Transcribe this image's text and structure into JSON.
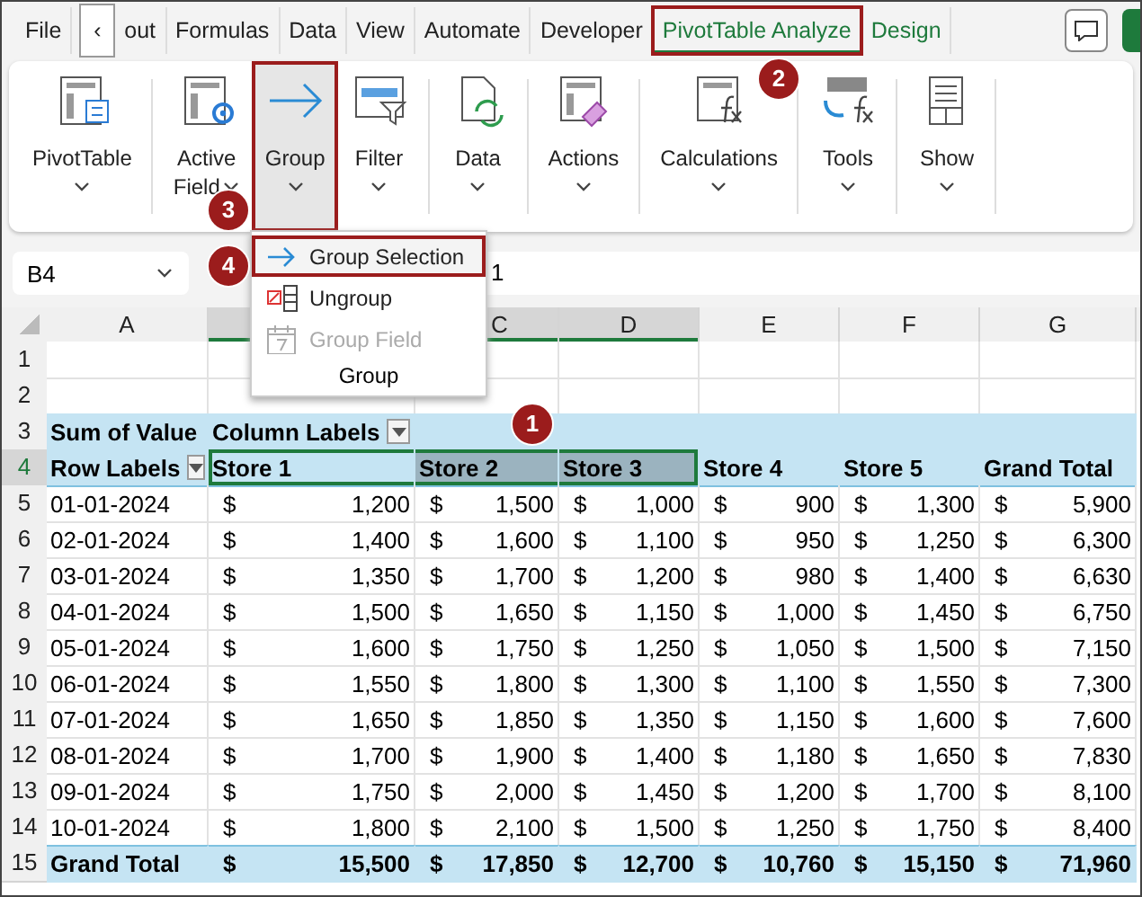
{
  "tabs": [
    {
      "label": "File",
      "kind": "normal",
      "selected": false,
      "outlined": false
    },
    {
      "label": "‹",
      "kind": "scroll",
      "selected": false,
      "outlined": false
    },
    {
      "label": "out",
      "kind": "normal",
      "selected": false,
      "outlined": false
    },
    {
      "label": "Formulas",
      "kind": "normal",
      "selected": false,
      "outlined": false
    },
    {
      "label": "Data",
      "kind": "normal",
      "selected": false,
      "outlined": false
    },
    {
      "label": "View",
      "kind": "normal",
      "selected": false,
      "outlined": false
    },
    {
      "label": "Automate",
      "kind": "normal",
      "selected": false,
      "outlined": false
    },
    {
      "label": "Developer",
      "kind": "normal",
      "selected": false,
      "outlined": false
    },
    {
      "label": "PivotTable Analyze",
      "kind": "contextual",
      "selected": true,
      "outlined": true
    },
    {
      "label": "Design",
      "kind": "contextual",
      "selected": false,
      "outlined": false
    }
  ],
  "ribbon": [
    {
      "buttons": [
        {
          "label": "PivotTable",
          "kind": "pivot",
          "pressed": false,
          "outlined": false
        }
      ]
    },
    {
      "buttons": [
        {
          "label": "Active",
          "label2": "Field",
          "kind": "field",
          "pressed": false,
          "outlined": false
        },
        {
          "label": "Group",
          "kind": "group",
          "pressed": true,
          "outlined": true
        },
        {
          "label": "Filter",
          "kind": "filter",
          "pressed": false,
          "outlined": false
        }
      ]
    },
    {
      "buttons": [
        {
          "label": "Data",
          "kind": "data",
          "pressed": false,
          "outlined": false
        }
      ]
    },
    {
      "buttons": [
        {
          "label": "Actions",
          "kind": "actions",
          "pressed": false,
          "outlined": false
        }
      ]
    },
    {
      "buttons": [
        {
          "label": "Calculations",
          "kind": "calc",
          "pressed": false,
          "outlined": false
        }
      ]
    },
    {
      "buttons": [
        {
          "label": "Tools",
          "kind": "tools",
          "pressed": false,
          "outlined": false
        }
      ]
    },
    {
      "buttons": [
        {
          "label": "Show",
          "kind": "show",
          "pressed": false,
          "outlined": false
        }
      ]
    }
  ],
  "name_box": "B4",
  "formula": "1",
  "menu": {
    "items": [
      {
        "label": "Group Selection",
        "kind": "arrow",
        "disabled": false,
        "selected": true
      },
      {
        "label": "Ungroup",
        "kind": "ungroup",
        "disabled": false,
        "selected": false
      },
      {
        "label": "Group Field",
        "kind": "calendar",
        "disabled": true,
        "selected": false
      }
    ],
    "footer": "Group"
  },
  "sheet": {
    "columns": [
      "A",
      "C",
      "D",
      "E",
      "F",
      "G"
    ],
    "rows": [
      {
        "number": "1",
        "kind": "blank",
        "cells": []
      },
      {
        "number": "2",
        "kind": "blank",
        "cells": []
      },
      {
        "number": "3",
        "kind": "label",
        "cells": [
          {
            "text": "Sum of Value"
          },
          {
            "text": "Column Labels",
            "filter": true
          }
        ]
      },
      {
        "number": "4",
        "kind": "header",
        "cells": [
          {
            "text": "Row Labels",
            "filter": true
          },
          {
            "text": "Store 1",
            "selected": false
          },
          {
            "text": "Store 2",
            "selected": true
          },
          {
            "text": "Store 3",
            "selected": true
          },
          {
            "text": "Store 4",
            "selected": false
          },
          {
            "text": "Store 5",
            "selected": false
          },
          {
            "text": "Grand Total",
            "selected": false
          }
        ]
      },
      {
        "number": "5",
        "kind": "data",
        "label": "01-01-2024",
        "values": [
          "1,200",
          "1,500",
          "1,000",
          "900",
          "1,300",
          "5,900"
        ]
      },
      {
        "number": "6",
        "kind": "data",
        "label": "02-01-2024",
        "values": [
          "1,400",
          "1,600",
          "1,100",
          "950",
          "1,250",
          "6,300"
        ]
      },
      {
        "number": "7",
        "kind": "data",
        "label": "03-01-2024",
        "values": [
          "1,350",
          "1,700",
          "1,200",
          "980",
          "1,400",
          "6,630"
        ]
      },
      {
        "number": "8",
        "kind": "data",
        "label": "04-01-2024",
        "values": [
          "1,500",
          "1,650",
          "1,150",
          "1,000",
          "1,450",
          "6,750"
        ]
      },
      {
        "number": "9",
        "kind": "data",
        "label": "05-01-2024",
        "values": [
          "1,600",
          "1,750",
          "1,250",
          "1,050",
          "1,500",
          "7,150"
        ]
      },
      {
        "number": "10",
        "kind": "data",
        "label": "06-01-2024",
        "values": [
          "1,550",
          "1,800",
          "1,300",
          "1,100",
          "1,550",
          "7,300"
        ]
      },
      {
        "number": "11",
        "kind": "data",
        "label": "07-01-2024",
        "values": [
          "1,650",
          "1,850",
          "1,350",
          "1,150",
          "1,600",
          "7,600"
        ]
      },
      {
        "number": "12",
        "kind": "data",
        "label": "08-01-2024",
        "values": [
          "1,700",
          "1,900",
          "1,400",
          "1,180",
          "1,650",
          "7,830"
        ]
      },
      {
        "number": "13",
        "kind": "data",
        "label": "09-01-2024",
        "values": [
          "1,750",
          "2,000",
          "1,450",
          "1,200",
          "1,700",
          "8,100"
        ]
      },
      {
        "number": "14",
        "kind": "data",
        "label": "10-01-2024",
        "values": [
          "1,800",
          "2,100",
          "1,500",
          "1,250",
          "1,750",
          "8,400"
        ]
      },
      {
        "number": "15",
        "kind": "total",
        "label": "Grand Total",
        "values": [
          "15,500",
          "17,850",
          "12,700",
          "10,760",
          "15,150",
          "71,960"
        ]
      }
    ],
    "currency": "$"
  },
  "callouts": [
    "1",
    "2",
    "3",
    "4"
  ]
}
